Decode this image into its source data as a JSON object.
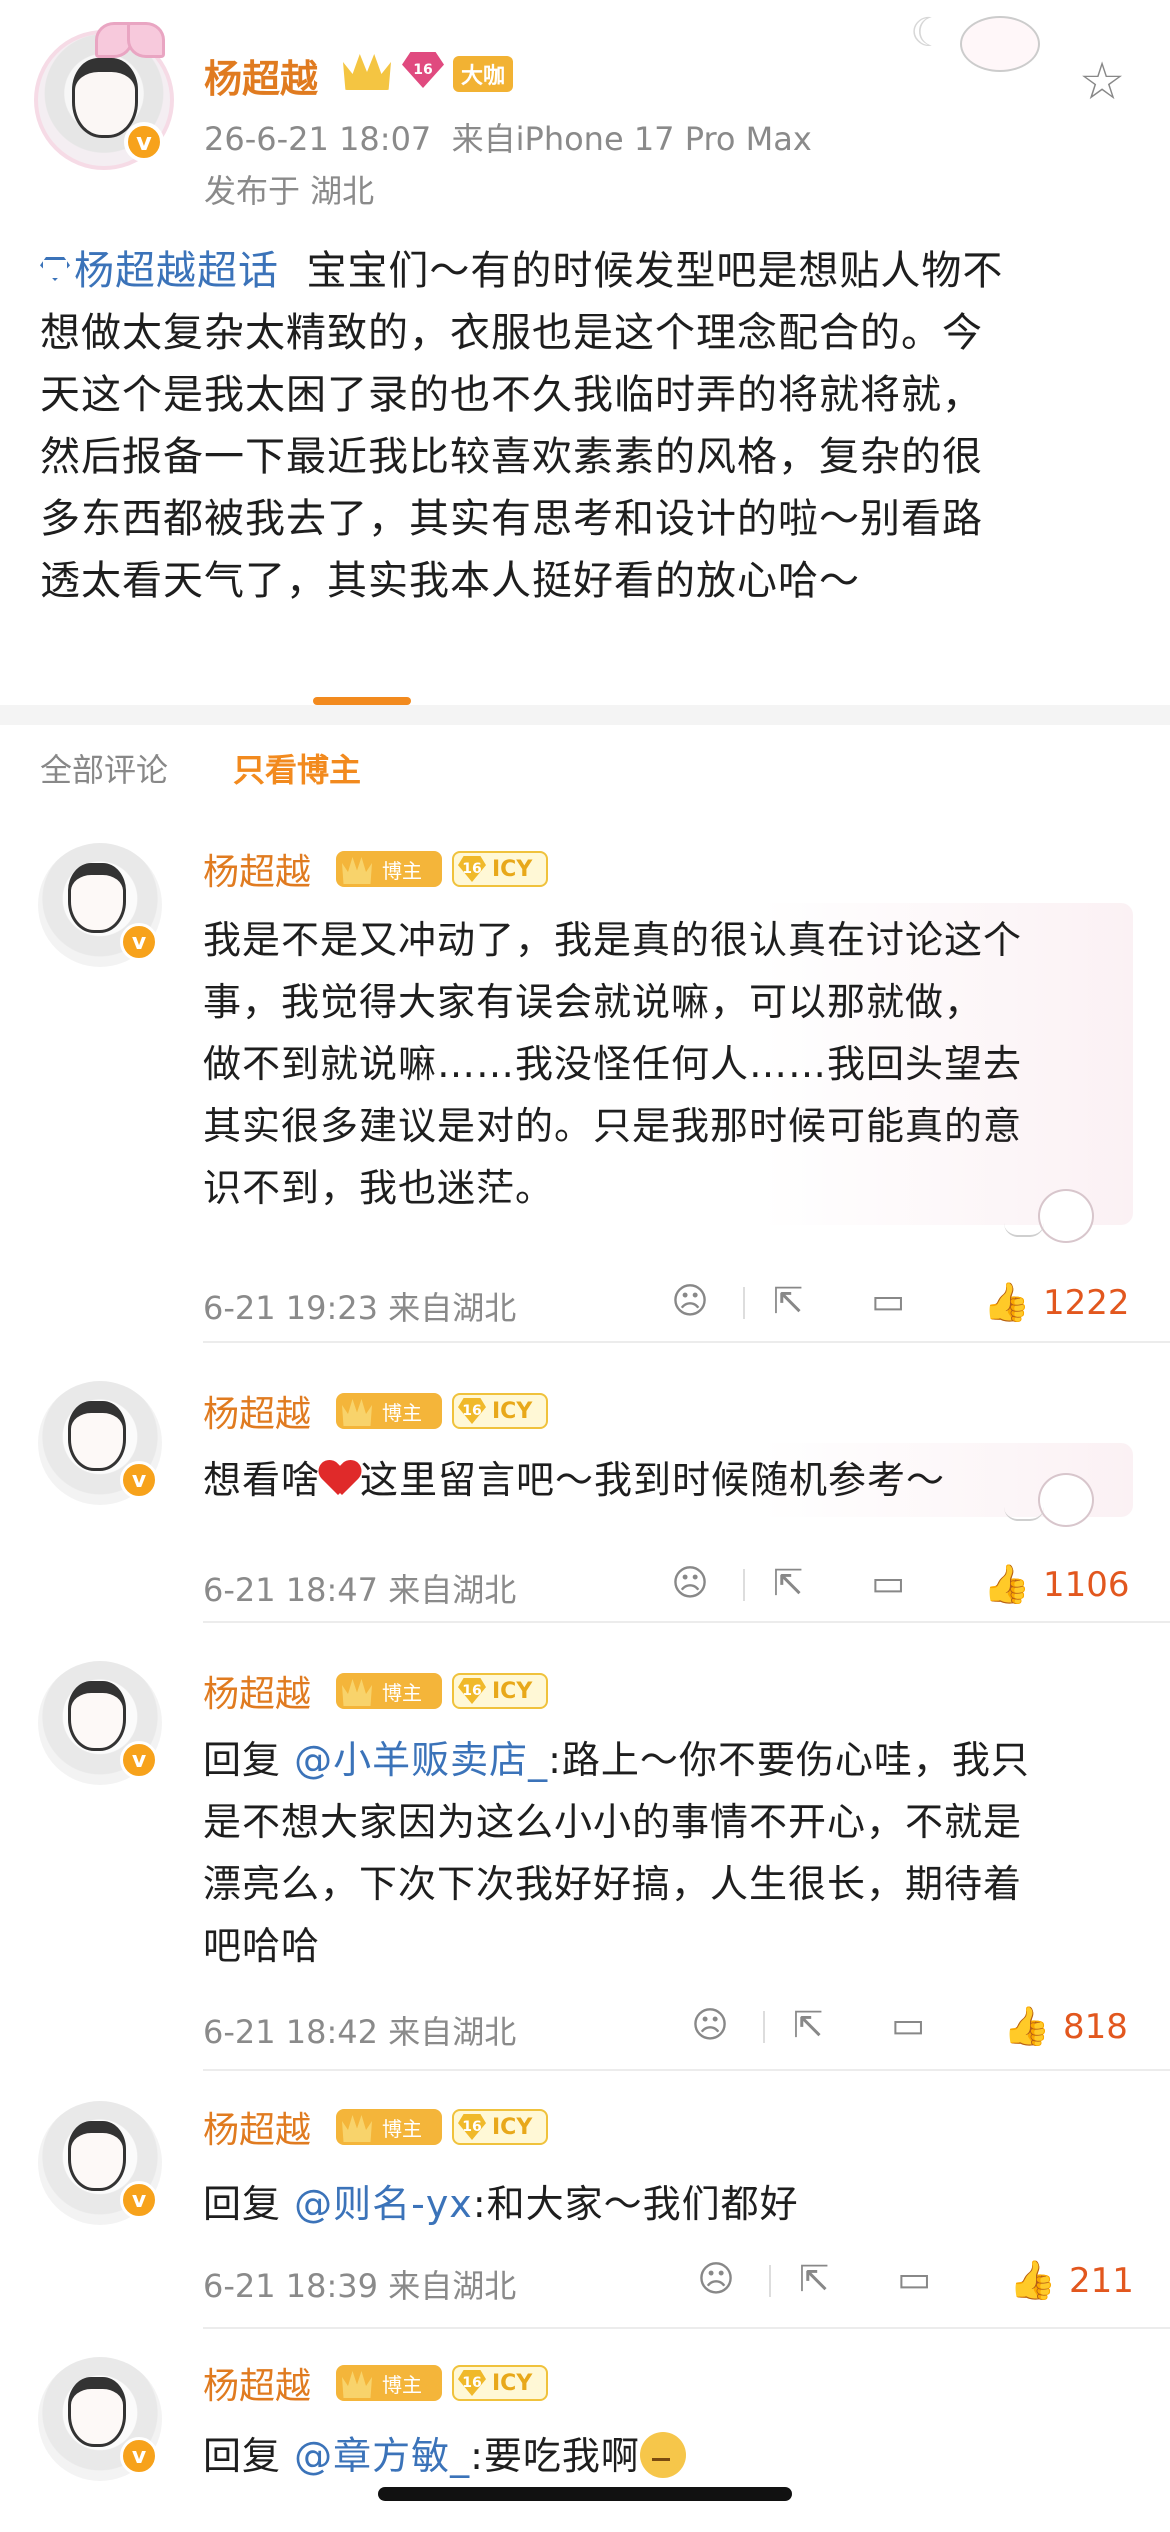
{
  "post": {
    "author": "杨超越",
    "fan_badge": "大咖",
    "diamond_level": "16",
    "timestamp": "26-6-21 18:07",
    "source": "来自iPhone 17 Pro Max",
    "location": "发布于 湖北",
    "topic": "杨超越超话",
    "text_lines": [
      "宝宝们～有的时候发型吧是想贴人物不",
      "想做太复杂太精致的，衣服也是这个理念配合的。今",
      "天这个是我太困了录的也不久我临时弄的将就将就，",
      "然后报备一下最近我比较喜欢素素的风格，复杂的很",
      "多东西都被我去了，其实有思考和设计的啦～别看路",
      "透太看天气了，其实我本人挺好看的放心哈～"
    ]
  },
  "tabs": {
    "all": "全部评论",
    "author_only": "只看博主"
  },
  "comments": [
    {
      "name": "杨超越",
      "badge": "博主",
      "icy": "ICY",
      "text_lines": [
        "我是不是又冲动了，我是真的很认真在讨论这个",
        "事，我觉得大家有误会就说嘛，可以那就做，",
        "做不到就说嘛……我没怪任何人……我回头望去",
        "其实很多建议是对的。只是我那时候可能真的意",
        "识不到，我也迷茫。"
      ],
      "time": "6-21 19:23 来自湖北",
      "likes": "1222"
    },
    {
      "name": "杨超越",
      "badge": "博主",
      "icy": "ICY",
      "text_before": "想看啥",
      "text_after": "这里留言吧～我到时候随机参考～",
      "time": "6-21 18:47 来自湖北",
      "likes": "1106"
    },
    {
      "name": "杨超越",
      "badge": "博主",
      "icy": "ICY",
      "reply_prefix": "回复",
      "mention": "@小羊贩卖店_",
      "first_line_rest": ":路上～你不要伤心哇，我只",
      "text_lines": [
        "是不想大家因为这么小小的事情不开心，不就是",
        "漂亮么，下次下次我好好搞，人生很长，期待着",
        "吧哈哈"
      ],
      "time": "6-21 18:42 来自湖北",
      "likes": "818"
    },
    {
      "name": "杨超越",
      "badge": "博主",
      "icy": "ICY",
      "reply_prefix": "回复",
      "mention": "@则名-yx",
      "first_line_rest": ":和大家～我们都好",
      "time": "6-21 18:39 来自湖北",
      "likes": "211"
    },
    {
      "name": "杨超越",
      "badge": "博主",
      "icy": "ICY",
      "reply_prefix": "回复",
      "mention": "@章方敏_",
      "first_line_rest": ":要吃我啊"
    }
  ],
  "icons": {
    "favorite": "star-icon",
    "dislike": "frown-icon",
    "share": "share-icon",
    "comment": "comment-icon",
    "like": "thumbs-up-icon"
  },
  "colors": {
    "name": "#e07b20",
    "link": "#3b73b9",
    "like": "#e2571e",
    "tab_active": "#f28a1e"
  }
}
